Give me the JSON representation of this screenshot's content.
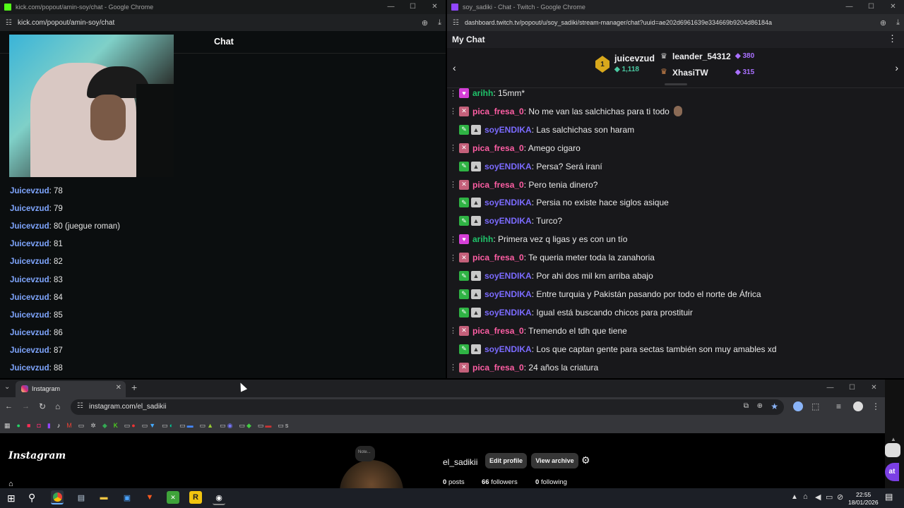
{
  "kick": {
    "title": "kick.com/popout/amin-soy/chat - Google Chrome",
    "url": "kick.com/popout/amin-soy/chat",
    "chat_header": "Chat",
    "messages": [
      {
        "user": "Juicevzud",
        "text": ": 78"
      },
      {
        "user": "Juicevzud",
        "text": ": 79"
      },
      {
        "user": "Juicevzud",
        "text": ": 80 (juegue roman)"
      },
      {
        "user": "Juicevzud",
        "text": ": 81"
      },
      {
        "user": "Juicevzud",
        "text": ": 82"
      },
      {
        "user": "Juicevzud",
        "text": ": 83"
      },
      {
        "user": "Juicevzud",
        "text": ": 84"
      },
      {
        "user": "Juicevzud",
        "text": ": 85"
      },
      {
        "user": "Juicevzud",
        "text": ": 86"
      },
      {
        "user": "Juicevzud",
        "text": ": 87"
      },
      {
        "user": "Juicevzud",
        "text": ": 88"
      }
    ]
  },
  "twitch": {
    "title": "soy_sadiki - Chat - Twitch - Google Chrome",
    "url": "dashboard.twitch.tv/popout/u/soy_sadiki/stream-manager/chat?uuid=ae202d6961639e334669b9204d86184a",
    "header": "My Chat",
    "leaderboard": {
      "first": {
        "name": "juicevzud",
        "points": "1,118",
        "rank": "1"
      },
      "second": {
        "name": "leander_54312",
        "points": "380"
      },
      "third": {
        "name": "XhasiTW",
        "points": "315"
      }
    },
    "messages": [
      {
        "badge": "heart",
        "name": "arihh",
        "color": "green",
        "text": ": 15mm*",
        "dots": true
      },
      {
        "badge": "x",
        "name": "pica_fresa_0",
        "color": "pink",
        "text": ": No me van las salchichas para ti todo",
        "dots": true,
        "emote": true
      },
      {
        "badge": "mod",
        "name": "soyENDIKA",
        "color": "blue",
        "text": ": Las salchichas son haram",
        "dots": false
      },
      {
        "badge": "x",
        "name": "pica_fresa_0",
        "color": "pink",
        "text": ": Amego cigaro",
        "dots": true
      },
      {
        "badge": "mod",
        "name": "soyENDIKA",
        "color": "blue",
        "text": ": Persa? Será iraní",
        "dots": false
      },
      {
        "badge": "x",
        "name": "pica_fresa_0",
        "color": "pink",
        "text": ": Pero tenia dinero?",
        "dots": true
      },
      {
        "badge": "mod",
        "name": "soyENDIKA",
        "color": "blue",
        "text": ": Persia no existe hace siglos asique",
        "dots": false
      },
      {
        "badge": "mod",
        "name": "soyENDIKA",
        "color": "blue",
        "text": ": Turco?",
        "dots": false
      },
      {
        "badge": "heart",
        "name": "arihh",
        "color": "green",
        "text": ": Primera vez q ligas y es con un tío",
        "dots": true
      },
      {
        "badge": "x",
        "name": "pica_fresa_0",
        "color": "pink",
        "text": ": Te queria meter toda la zanahoria",
        "dots": true
      },
      {
        "badge": "mod",
        "name": "soyENDIKA",
        "color": "blue",
        "text": ": Por ahi dos mil km arriba abajo",
        "dots": false
      },
      {
        "badge": "mod",
        "name": "soyENDIKA",
        "color": "blue",
        "text": ": Entre turquia y Pakistán pasando por todo el norte de África",
        "dots": false
      },
      {
        "badge": "mod",
        "name": "soyENDIKA",
        "color": "blue",
        "text": ": Igual está buscando chicos para prostituir",
        "dots": false
      },
      {
        "badge": "x",
        "name": "pica_fresa_0",
        "color": "pink",
        "text": ": Tremendo el tdh que tiene",
        "dots": true
      },
      {
        "badge": "mod",
        "name": "soyENDIKA",
        "color": "blue",
        "text": ": Los que captan gente para sectas también son muy amables xd",
        "dots": false
      },
      {
        "badge": "x",
        "name": "pica_fresa_0",
        "color": "pink",
        "text": ": 24 años la criatura",
        "dots": true
      }
    ]
  },
  "instagram": {
    "tab_title": "Instagram",
    "url": "instagram.com/el_sadikii",
    "logo": "Instagram",
    "username": "el_sadikii",
    "edit_profile": "Edit profile",
    "view_archive": "View archive",
    "note": "Note...",
    "posts_count": "0",
    "posts_label": "posts",
    "followers_count": "66",
    "followers_label": "followers",
    "following_count": "0",
    "following_label": "following",
    "bookmark_last": "s",
    "chat_fab": "at"
  },
  "taskbar": {
    "time": "22:55",
    "date": "18/01/2026"
  }
}
